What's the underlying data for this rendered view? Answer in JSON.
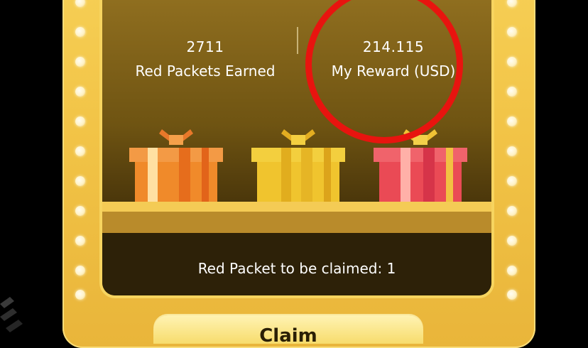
{
  "stats": {
    "packets_earned_value": "2711",
    "packets_earned_label": "Red Packets Earned",
    "reward_value": "214.115",
    "reward_label": "My Reward (USD)"
  },
  "claim_info": "Red Packet to be claimed: 1",
  "claim_button_label": "Claim",
  "colors": {
    "frame_gold": "#f2c447",
    "panel_brown": "#6f5412",
    "highlight_circle": "#e8140f",
    "gift_orange": "#f08a2a",
    "gift_yellow": "#f0c42e",
    "gift_red": "#ea4a55"
  },
  "gifts": [
    "orange-gift-box-icon",
    "yellow-gift-box-icon",
    "red-gift-box-icon"
  ]
}
